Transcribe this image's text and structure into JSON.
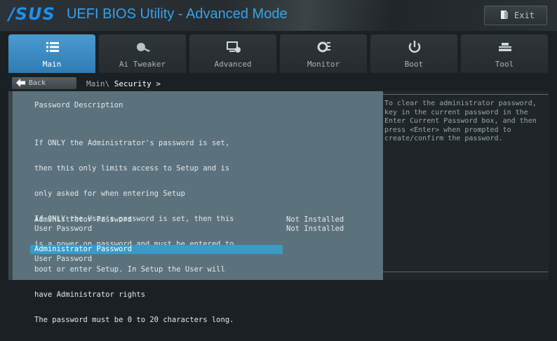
{
  "title_bar": {
    "logo": "/SUS",
    "app_title": "UEFI BIOS Utility - Advanced Mode",
    "exit_label": "Exit",
    "exit_icon": "exit-door-icon"
  },
  "tabs": [
    {
      "label": "Main",
      "icon": "list-icon",
      "active": true
    },
    {
      "label": "Ai Tweaker",
      "icon": "tweaker-icon",
      "active": false
    },
    {
      "label": "Advanced",
      "icon": "advanced-icon",
      "active": false
    },
    {
      "label": "Monitor",
      "icon": "monitor-icon",
      "active": false
    },
    {
      "label": "Boot",
      "icon": "power-icon",
      "active": false
    },
    {
      "label": "Tool",
      "icon": "tool-icon",
      "active": false
    }
  ],
  "breadcrumb": {
    "back_label": "Back",
    "path": "Main\\",
    "current": "Security >"
  },
  "main": {
    "description_title": "Password Description",
    "description_lines": [
      "If ONLY the Administrator's password is set,",
      "then this only limits access to Setup and is",
      "only asked for when entering Setup",
      "If ONLY the User's password is set, then this",
      "is a power on password and must be entered to",
      "boot or enter Setup. In Setup the User will",
      "have Administrator rights",
      "The password must be 0 to 20 characters long."
    ],
    "status": [
      {
        "label": "Administrator Password",
        "value": "Not Installed"
      },
      {
        "label": "User Password",
        "value": "Not Installed"
      }
    ],
    "menu_items": [
      {
        "label": "Administrator Password",
        "selected": true
      },
      {
        "label": "User Password",
        "selected": false
      }
    ]
  },
  "help": {
    "text": "To clear the administrator password, key in the current password in the Enter Current Password box, and then press <Enter> when prompted to create/confirm the password."
  },
  "colors": {
    "accent": "#3b9ac6",
    "panel": "#5b727c",
    "logo": "#1e8ff0"
  }
}
